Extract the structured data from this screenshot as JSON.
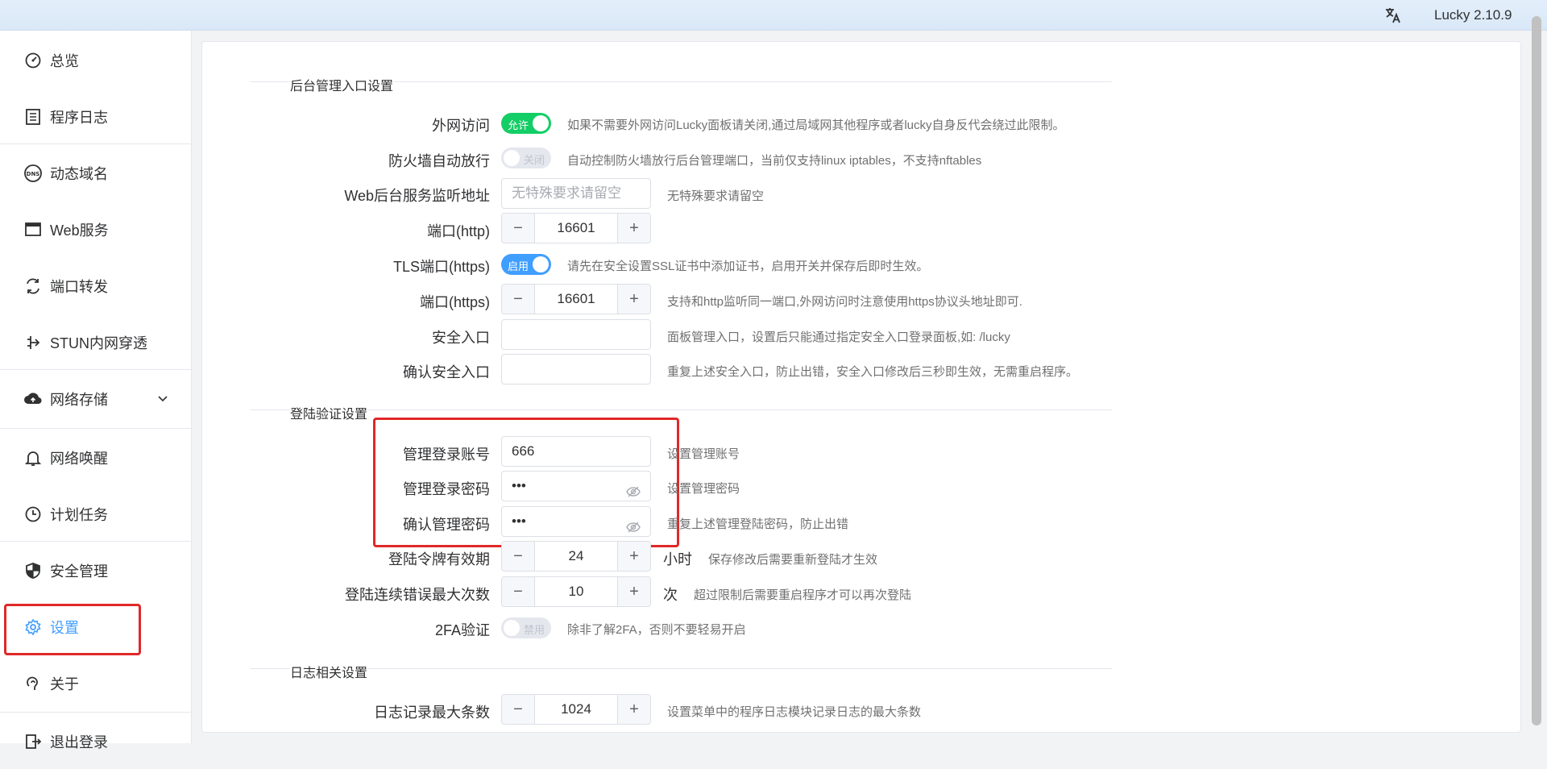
{
  "header": {
    "version": "Lucky 2.10.9",
    "lang_icon": "translate-icon"
  },
  "sidebar": {
    "items": [
      {
        "label": "总览",
        "icon": "dashboard-icon"
      },
      {
        "label": "程序日志",
        "icon": "log-icon"
      },
      {
        "label": "动态域名",
        "icon": "dns-icon"
      },
      {
        "label": "Web服务",
        "icon": "web-icon"
      },
      {
        "label": "端口转发",
        "icon": "port-forward-icon"
      },
      {
        "label": "STUN内网穿透",
        "icon": "stun-icon"
      },
      {
        "label": "网络存储",
        "icon": "cloud-upload-icon"
      },
      {
        "label": "网络唤醒",
        "icon": "bell-icon"
      },
      {
        "label": "计划任务",
        "icon": "clock-icon"
      },
      {
        "label": "安全管理",
        "icon": "shield-icon"
      },
      {
        "label": "设置",
        "icon": "gear-icon"
      },
      {
        "label": "关于",
        "icon": "about-icon"
      },
      {
        "label": "退出登录",
        "icon": "logout-icon"
      }
    ]
  },
  "sections": {
    "admin": "后台管理入口设置",
    "login": "登陆验证设置",
    "log": "日志相关设置"
  },
  "rows": {
    "external": {
      "label": "外网访问",
      "state": "允许",
      "hint": "如果不需要外网访问Lucky面板请关闭,通过局域网其他程序或者lucky自身反代会绕过此限制。"
    },
    "firewall": {
      "label": "防火墙自动放行",
      "state": "关闭",
      "hint": "自动控制防火墙放行后台管理端口，当前仅支持linux iptables，不支持nftables"
    },
    "listen": {
      "label": "Web后台服务监听地址",
      "placeholder": "无特殊要求请留空",
      "hint": "无特殊要求请留空"
    },
    "http_port": {
      "label": "端口(http)",
      "value": "16601"
    },
    "tls": {
      "label": "TLS端口(https)",
      "state": "启用",
      "hint": "请先在安全设置SSL证书中添加证书，启用开关并保存后即时生效。"
    },
    "https_port": {
      "label": "端口(https)",
      "value": "16601",
      "hint": "支持和http监听同一端口,外网访问时注意使用https协议头地址即可."
    },
    "safe_entry": {
      "label": "安全入口",
      "value": "",
      "hint": "面板管理入口，设置后只能通过指定安全入口登录面板,如: /lucky"
    },
    "confirm_entry": {
      "label": "确认安全入口",
      "value": "",
      "hint": "重复上述安全入口，防止出错，安全入口修改后三秒即生效，无需重启程序。"
    },
    "account": {
      "label": "管理登录账号",
      "value": "666",
      "hint": "设置管理账号"
    },
    "password": {
      "label": "管理登录密码",
      "value": "•••",
      "hint": "设置管理密码"
    },
    "confirm_password": {
      "label": "确认管理密码",
      "value": "•••",
      "hint": "重复上述管理登陆密码，防止出错"
    },
    "token": {
      "label": "登陆令牌有效期",
      "value": "24",
      "unit": "小时",
      "hint": "保存修改后需要重新登陆才生效"
    },
    "max_errors": {
      "label": "登陆连续错误最大次数",
      "value": "10",
      "unit": "次",
      "hint": "超过限制后需要重启程序才可以再次登陆"
    },
    "twofa": {
      "label": "2FA验证",
      "state": "禁用",
      "hint": "除非了解2FA，否则不要轻易开启"
    },
    "log_max": {
      "label": "日志记录最大条数",
      "value": "1024",
      "hint": "设置菜单中的程序日志模块记录日志的最大条数"
    }
  },
  "colors": {
    "accent": "#409eff",
    "switch_on": "#13ce66",
    "highlight": "#e02828"
  }
}
